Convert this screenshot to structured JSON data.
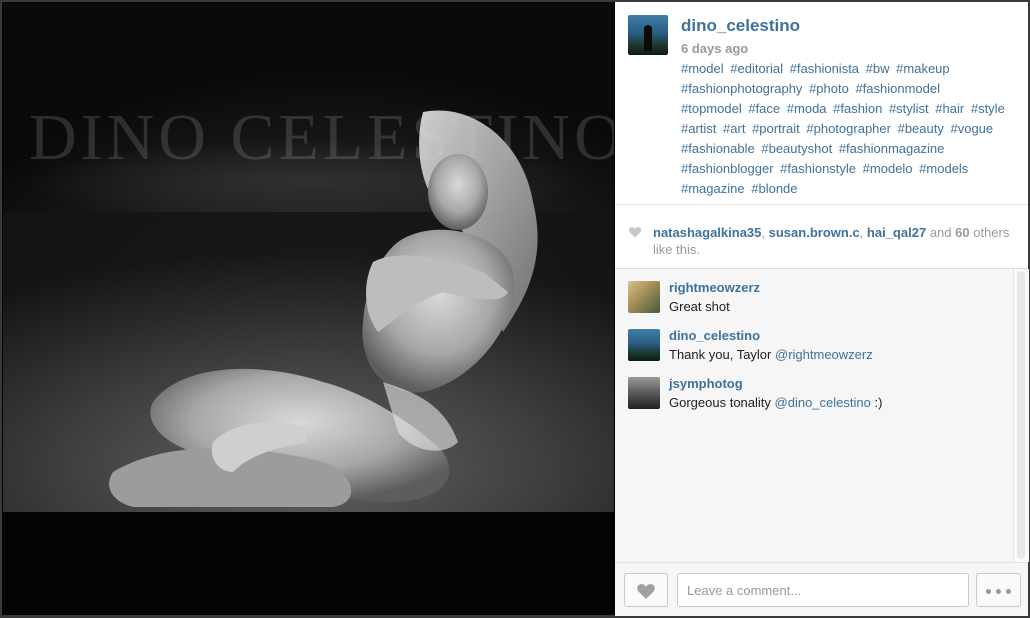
{
  "photo": {
    "watermark": "DINO CELESTINO"
  },
  "post": {
    "username": "dino_celestino",
    "time_ago": "6 days ago",
    "hashtags": [
      "#model",
      "#editorial",
      "#fashionista",
      "#bw",
      "#makeup",
      "#fashionphotography",
      "#photo",
      "#fashionmodel",
      "#topmodel",
      "#face",
      "#moda",
      "#fashion",
      "#stylist",
      "#hair",
      "#style",
      "#artist",
      "#art",
      "#portrait",
      "#photographer",
      "#beauty",
      "#vogue",
      "#fashionable",
      "#beautyshot",
      "#fashionmagazine",
      "#fashionblogger",
      "#fashionstyle",
      "#modelo",
      "#models",
      "#magazine",
      "#blonde"
    ]
  },
  "likes": {
    "likers": [
      "natashagalkina35",
      "susan.brown.c",
      "hai_qal27"
    ],
    "separator": ",",
    "and_text": "and",
    "others_count": "60",
    "suffix": "others like this."
  },
  "comments": [
    {
      "user": "rightmeowzerz",
      "text": "Great shot",
      "mention": "",
      "after": ""
    },
    {
      "user": "dino_celestino",
      "text": "Thank you, Taylor",
      "mention": "@rightmeowzerz",
      "after": ""
    },
    {
      "user": "jsymphotog",
      "text": "Gorgeous tonality",
      "mention": "@dino_celestino",
      "after": ":)"
    }
  ],
  "footer": {
    "comment_placeholder": "Leave a comment..."
  },
  "icons": {
    "heart": "heart-icon",
    "more": "more-dots-icon"
  },
  "colors": {
    "link": "#3f729b",
    "muted": "#999999",
    "panel_bg": "#f6f6f6"
  }
}
